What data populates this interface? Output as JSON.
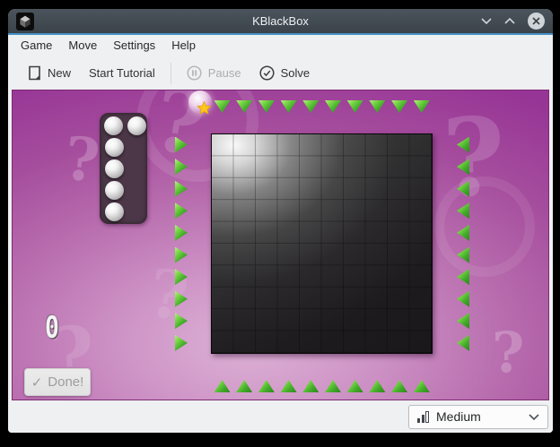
{
  "window": {
    "title": "KBlackBox"
  },
  "menubar": {
    "items": [
      "Game",
      "Move",
      "Settings",
      "Help"
    ]
  },
  "toolbar": {
    "new_label": "New",
    "tutorial_label": "Start Tutorial",
    "pause_label": "Pause",
    "solve_label": "Solve"
  },
  "game": {
    "grid_columns": 10,
    "grid_rows": 10,
    "balls_in_tray": 6,
    "score": "0",
    "done_label": "Done!",
    "done_check": "✓",
    "question_mark": "?"
  },
  "statusbar": {
    "difficulty": "Medium"
  },
  "colors": {
    "accent_blue": "#4292c6",
    "background_magenta": "#a54d9d",
    "laser_green": "#44ac2a",
    "titlebar": "#434b53"
  }
}
